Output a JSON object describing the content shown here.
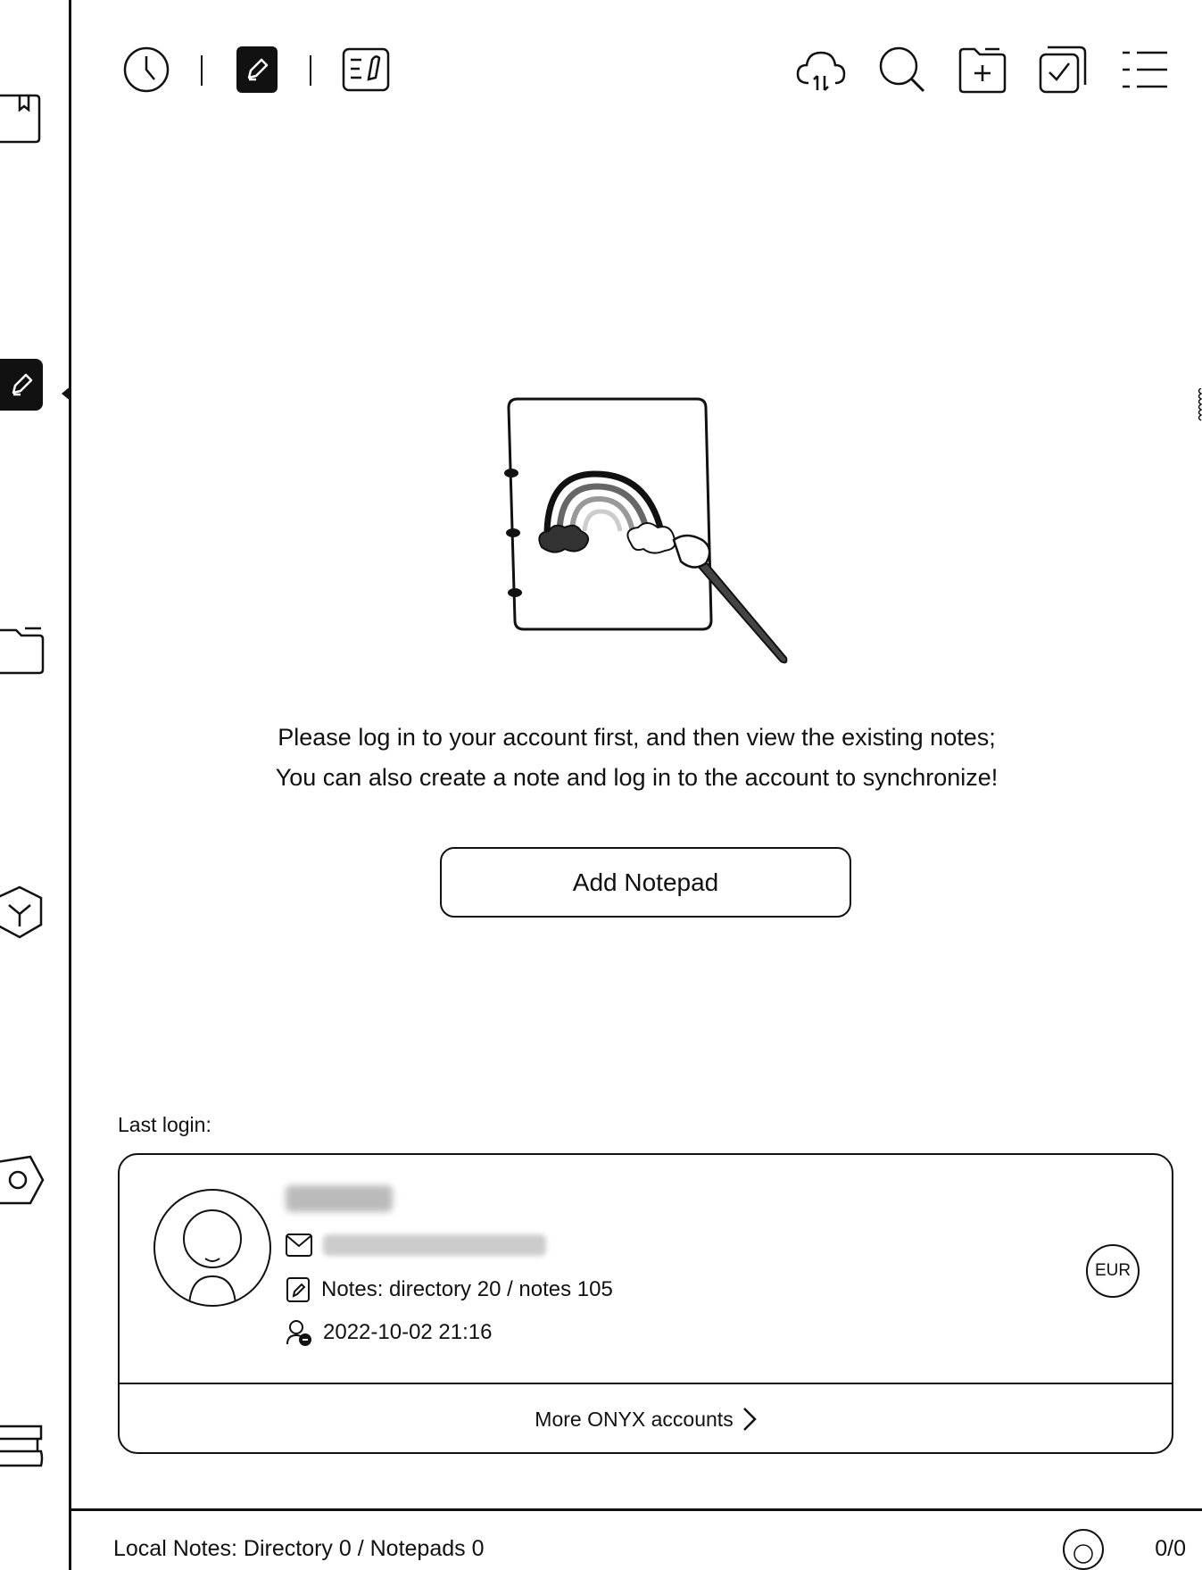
{
  "sidebar": {
    "items": [
      {
        "icon": "bookmark-book-icon"
      },
      {
        "icon": "pencil-note-icon",
        "active": true
      },
      {
        "icon": "folder-icon"
      },
      {
        "icon": "apps-cube-icon"
      },
      {
        "icon": "settings-hex-icon"
      },
      {
        "icon": "books-stack-icon"
      }
    ]
  },
  "toolbar": {
    "left": [
      "clock-icon",
      "pencil-note-icon",
      "note-list-icon"
    ],
    "right": [
      "cloud-sync-icon",
      "search-icon",
      "add-folder-icon",
      "multi-select-icon",
      "list-view-icon"
    ]
  },
  "main": {
    "message_line1": "Please log in to your account first, and then view the existing notes;",
    "message_line2": "You can also create a note and log in to the account to synchronize!",
    "add_notepad_label": "Add Notepad"
  },
  "last_login": {
    "label": "Last login:",
    "notes_stats": "Notes: directory 20 / notes 105",
    "login_time": "2022-10-02 21:16",
    "currency": "EUR",
    "more_accounts": "More ONYX accounts"
  },
  "footer": {
    "local_notes": "Local Notes: Directory 0 / Notepads 0",
    "page_counter": "0/0"
  }
}
